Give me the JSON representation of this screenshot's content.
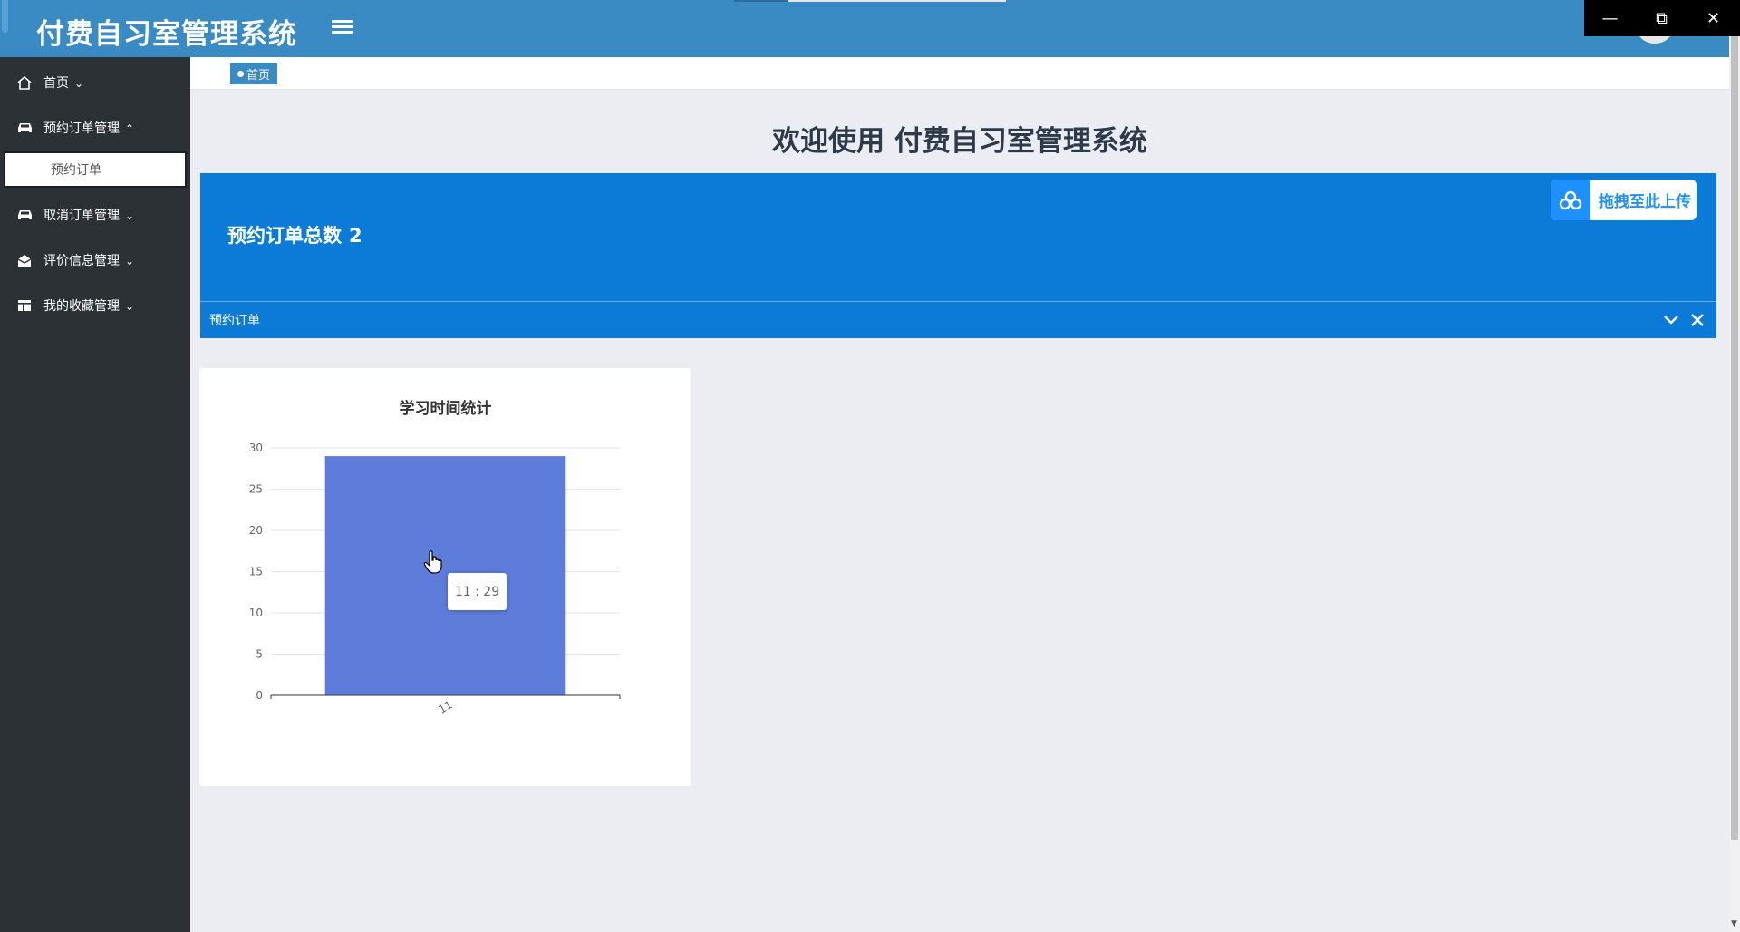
{
  "app": {
    "title": "付费自习室管理系统"
  },
  "sidebar": {
    "items": [
      {
        "label": "首页",
        "icon": "home-icon"
      },
      {
        "label": "预约订单管理",
        "icon": "car-icon",
        "expanded": true
      },
      {
        "label": "取消订单管理",
        "icon": "car-icon"
      },
      {
        "label": "评价信息管理",
        "icon": "envelope-open-icon"
      },
      {
        "label": "我的收藏管理",
        "icon": "table-layout-icon"
      }
    ],
    "sub_item": {
      "label": "预约订单"
    }
  },
  "breadcrumb": {
    "label": "首页"
  },
  "welcome": {
    "text": "欢迎使用 付费自习室管理系统"
  },
  "panel": {
    "count_label": "预约订单总数",
    "count_value": "2",
    "upload_label": "拖拽至此上传",
    "footer_label": "预约订单"
  },
  "colors": {
    "header": "#3A8AC4",
    "sidebar": "#2C3136",
    "panel": "#0C7BD8",
    "bar": "#5E7CD9"
  },
  "chart_data": {
    "type": "bar",
    "title": "学习时间统计",
    "categories": [
      "11"
    ],
    "values": [
      29
    ],
    "ylim": [
      0,
      30
    ],
    "yticks": [
      0,
      5,
      10,
      15,
      20,
      25,
      30
    ],
    "grid": true,
    "tooltip": "11 : 29"
  }
}
